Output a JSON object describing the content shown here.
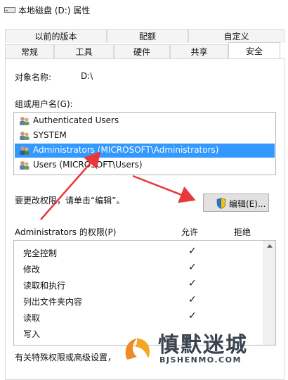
{
  "window": {
    "title": "本地磁盘 (D:) 属性"
  },
  "tabs_row1": [
    "以前的版本",
    "配额",
    "自定义"
  ],
  "tabs_row2": [
    "常规",
    "工具",
    "硬件",
    "共享",
    "安全"
  ],
  "security": {
    "object_label": "对象名称:",
    "object_value": "D:\\",
    "group_label": "组或用户名(G):",
    "users": [
      {
        "name": "Authenticated Users",
        "selected": false
      },
      {
        "name": "SYSTEM",
        "selected": false
      },
      {
        "name": "Administrators (MICROSOFT\\Administrators)",
        "selected": true
      },
      {
        "name": "Users (MICROSOFT\\Users)",
        "selected": false
      }
    ],
    "edit_hint": "要更改权限，请单击“编辑”。",
    "edit_button": "编辑(E)...",
    "perm_header": "Administrators 的权限(P)",
    "allow_header": "允许",
    "deny_header": "拒绝",
    "permissions": [
      {
        "name": "完全控制",
        "allow": true
      },
      {
        "name": "修改",
        "allow": true
      },
      {
        "name": "读取和执行",
        "allow": true
      },
      {
        "name": "列出文件夹内容",
        "allow": true
      },
      {
        "name": "读取",
        "allow": true
      },
      {
        "name": "写入",
        "allow": false
      }
    ],
    "check_mark": "✓",
    "special_note": "有关特殊权限或高级设置，"
  },
  "watermark": {
    "text": "慎默迷城",
    "url": "BJSHENMO.COM"
  },
  "colors": {
    "selection": "#3399ff",
    "arrow": "#e8383b"
  }
}
